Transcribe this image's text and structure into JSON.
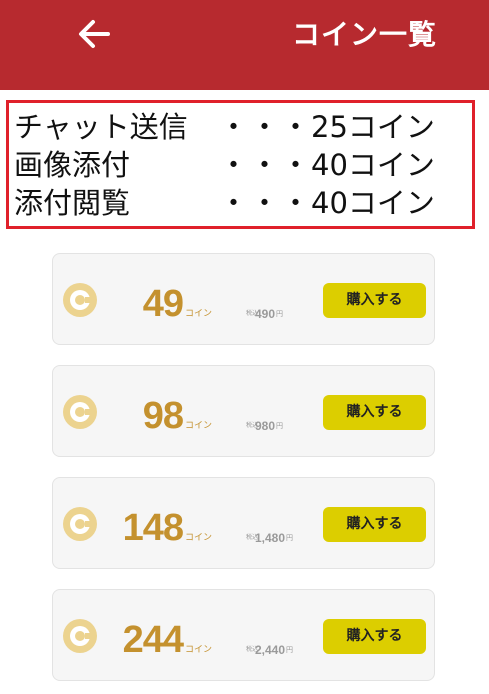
{
  "header": {
    "title": "コイン一覧",
    "back_icon": "arrow-left-icon",
    "color": "#b72a2f"
  },
  "info": {
    "dots": "・・・",
    "rows": [
      {
        "label": "チャット送信",
        "price": "25コイン"
      },
      {
        "label": "画像添付",
        "price": "40コイン"
      },
      {
        "label": "添付閲覧",
        "price": "40コイン"
      }
    ]
  },
  "packages": [
    {
      "amount": "49",
      "unit": "コイン",
      "tax_label": "税込",
      "price": "490",
      "price_unit": "円",
      "button": "購入する"
    },
    {
      "amount": "98",
      "unit": "コイン",
      "tax_label": "税込",
      "price": "980",
      "price_unit": "円",
      "button": "購入する"
    },
    {
      "amount": "148",
      "unit": "コイン",
      "tax_label": "税込",
      "price": "1,480",
      "price_unit": "円",
      "button": "購入する"
    },
    {
      "amount": "244",
      "unit": "コイン",
      "tax_label": "税込",
      "price": "2,440",
      "price_unit": "円",
      "button": "購入する"
    }
  ],
  "colors": {
    "accent_border": "#e0202a",
    "coin_gold": "#c4912e",
    "button_yellow": "#dcce00"
  }
}
